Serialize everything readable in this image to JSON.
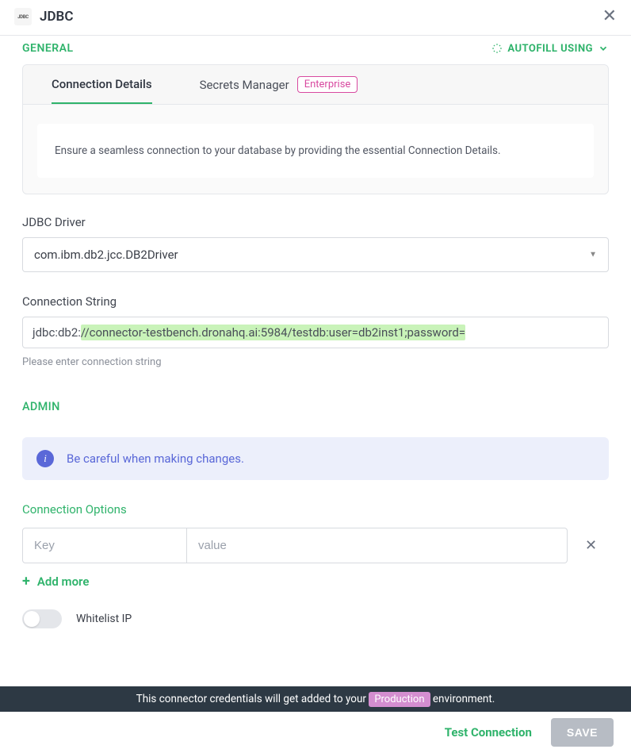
{
  "header": {
    "logo_text": "JDBC",
    "title": "JDBC"
  },
  "general": {
    "section_label": "GENERAL",
    "autofill_label": "AUTOFILL USING",
    "tabs": {
      "connection_details": "Connection Details",
      "secrets_manager": "Secrets Manager",
      "enterprise_badge": "Enterprise"
    },
    "hint": "Ensure a seamless connection to your database by providing the essential Connection Details.",
    "driver_label": "JDBC Driver",
    "driver_value": "com.ibm.db2.jcc.DB2Driver",
    "connstr_label": "Connection String",
    "connstr_prefix": "jdbc:db2:",
    "connstr_highlight": "//connector-testbench.dronahq.ai:5984/testdb:user=db2inst1;password=",
    "connstr_note": "Please enter connection string"
  },
  "admin": {
    "section_label": "ADMIN",
    "alert": "Be careful when making changes.",
    "conn_options_label": "Connection Options",
    "key_placeholder": "Key",
    "value_placeholder": "value",
    "add_more": "Add more",
    "whitelist_label": "Whitelist IP"
  },
  "env_bar": {
    "prefix": "This connector credentials will get added to your ",
    "badge": "Production",
    "suffix": " environment."
  },
  "footer": {
    "test": "Test Connection",
    "save": "SAVE"
  }
}
